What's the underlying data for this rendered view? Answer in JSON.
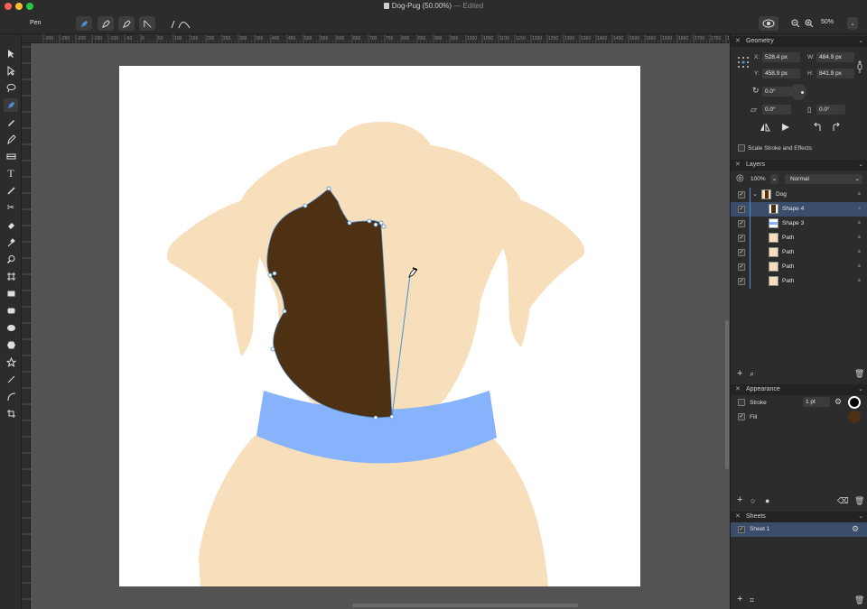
{
  "window": {
    "title": "Dog-Pug (50.00%)",
    "edited": "— Edited"
  },
  "toolbar": {
    "tool_name": "Pen",
    "zoom": "50%"
  },
  "ruler": {
    "labels": [
      "-300",
      "-250",
      "-200",
      "-150",
      "-100",
      "-50",
      "0",
      "50",
      "100",
      "150",
      "200",
      "250",
      "300",
      "350",
      "400",
      "450",
      "500",
      "550",
      "600",
      "650",
      "700",
      "750",
      "800",
      "850",
      "900",
      "950",
      "1000",
      "1050",
      "1100",
      "1150",
      "1200",
      "1250",
      "1300",
      "1350",
      "1400",
      "1450",
      "1500",
      "1550",
      "1600",
      "1650",
      "1700",
      "1750",
      "1800",
      "1850",
      "1900"
    ]
  },
  "geometry": {
    "title": "Geometry",
    "x_label": "X:",
    "x_value": "528.4 px",
    "w_label": "W:",
    "w_value": "484.9 px",
    "y_label": "Y:",
    "y_value": "458.9 px",
    "h_label": "H:",
    "h_value": "841.9 px",
    "rotation": "0.0°",
    "shear": "0.0°",
    "skew": "0.0°",
    "scale_stroke_label": "Scale Stroke and Effects"
  },
  "layers": {
    "title": "Layers",
    "opacity": "100%",
    "blend_mode": "Normal",
    "items": [
      {
        "name": "Dog"
      },
      {
        "name": "Shape 4"
      },
      {
        "name": "Shape 3"
      },
      {
        "name": "Path"
      },
      {
        "name": "Path"
      },
      {
        "name": "Path"
      },
      {
        "name": "Path"
      }
    ]
  },
  "appearance": {
    "title": "Appearance",
    "stroke_label": "Stroke",
    "stroke_width": "1 pt",
    "fill_label": "Fill",
    "stroke_color": "#000000",
    "fill_color": "#4e3013"
  },
  "sheets": {
    "title": "Sheets",
    "items": [
      {
        "name": "Sheet 1"
      }
    ]
  },
  "colors": {
    "accent": "#4c8fd6",
    "dog_body": "#f6dfba",
    "collar": "#86b3fb",
    "patch": "#4e3013"
  }
}
